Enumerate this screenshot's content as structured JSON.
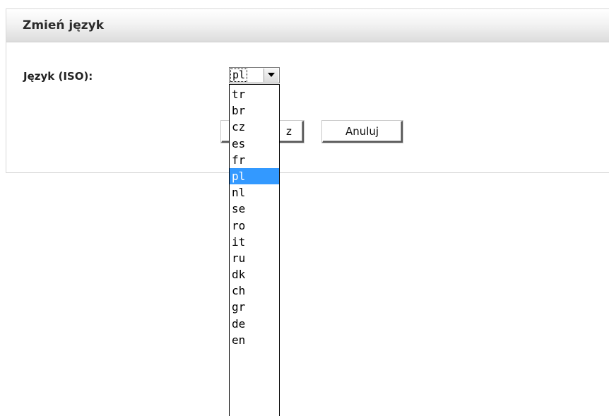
{
  "dialog": {
    "title": "Zmień język",
    "field_label": "Język (ISO):",
    "selected_value": "pl",
    "save_button_partial": "z",
    "cancel_button": "Anuluj"
  },
  "dropdown": {
    "options": [
      "tr",
      "br",
      "cz",
      "es",
      "fr",
      "pl",
      "nl",
      "se",
      "ro",
      "it",
      "ru",
      "dk",
      "ch",
      "gr",
      "de",
      "en"
    ],
    "highlighted": "pl"
  },
  "colors": {
    "highlight": "#3399ff",
    "header_gradient_end": "#dcdcdc"
  }
}
